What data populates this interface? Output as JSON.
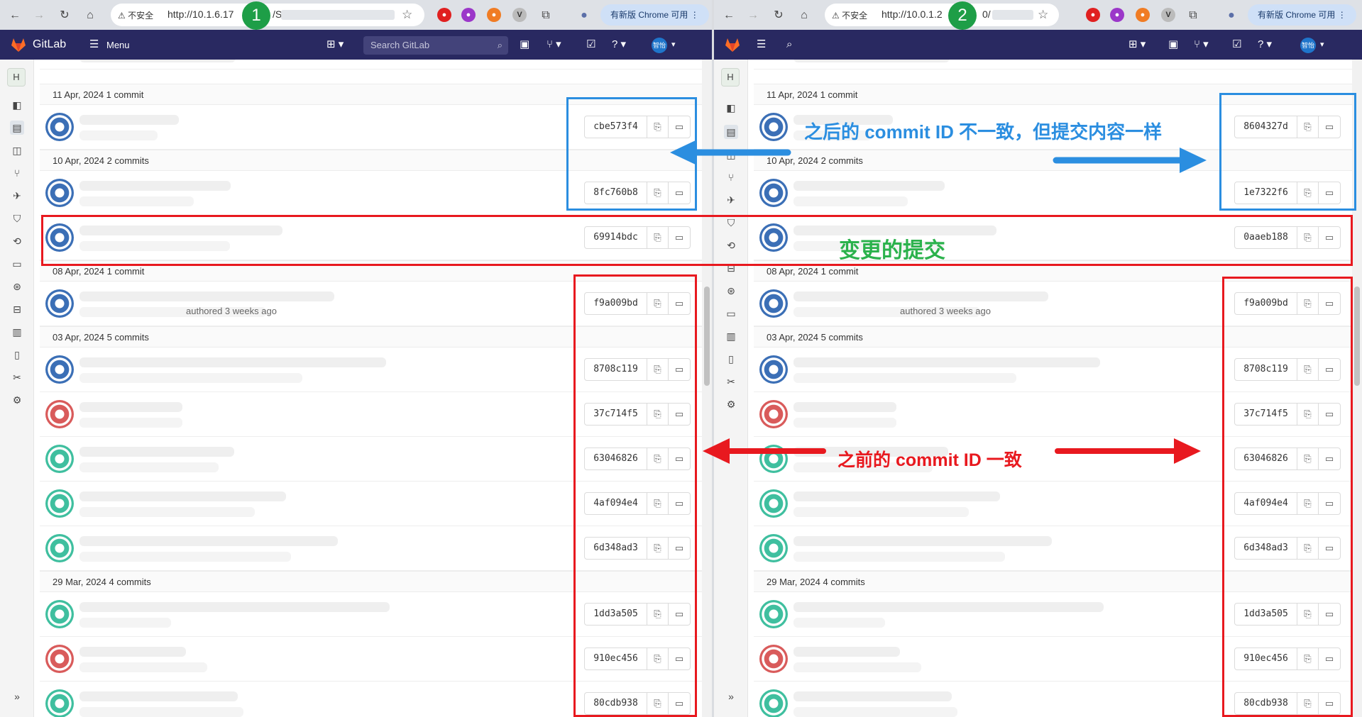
{
  "left": {
    "browser": {
      "insecure_label": "不安全",
      "url": "http://10.1.6.17",
      "url_tail": "/S",
      "update_label": "有新版 Chrome 可用",
      "marker": "1"
    },
    "gitlab": {
      "brand": "GitLab",
      "menu_label": "Menu",
      "search_placeholder": "Search GitLab",
      "avatar_text": "智怡",
      "sidebar_initial": "H"
    },
    "groups": [
      {
        "header": "11 Apr, 2024 1 commit",
        "rows": [
          {
            "sha": "cbe573f4"
          }
        ]
      },
      {
        "header": "10 Apr, 2024 2 commits",
        "rows": [
          {
            "sha": "8fc760b8"
          },
          {
            "sha": "69914bdc"
          }
        ]
      },
      {
        "header": "08 Apr, 2024 1 commit",
        "rows": [
          {
            "sha": "f9a009bd",
            "meta": "authored 3 weeks ago"
          }
        ]
      },
      {
        "header": "03 Apr, 2024 5 commits",
        "rows": [
          {
            "sha": "8708c119"
          },
          {
            "sha": "37c714f5"
          },
          {
            "sha": "63046826"
          },
          {
            "sha": "4af094e4"
          },
          {
            "sha": "6d348ad3"
          }
        ]
      },
      {
        "header": "29 Mar, 2024 4 commits",
        "rows": [
          {
            "sha": "1dd3a505"
          },
          {
            "sha": "910ec456"
          },
          {
            "sha": "80cdb938"
          }
        ]
      }
    ]
  },
  "right": {
    "browser": {
      "insecure_label": "不安全",
      "url": "http://10.0.1.2",
      "url_tail": "0/",
      "update_label": "有新版 Chrome 可用",
      "marker": "2"
    },
    "gitlab": {
      "avatar_text": "智怡",
      "sidebar_initial": "H"
    },
    "groups": [
      {
        "header": "11 Apr, 2024 1 commit",
        "rows": [
          {
            "sha": "8604327d"
          }
        ]
      },
      {
        "header": "10 Apr, 2024 2 commits",
        "rows": [
          {
            "sha": "1e7322f6"
          },
          {
            "sha": "0aaeb188"
          }
        ]
      },
      {
        "header": "08 Apr, 2024 1 commit",
        "rows": [
          {
            "sha": "f9a009bd",
            "meta": "authored 3 weeks ago"
          }
        ]
      },
      {
        "header": "03 Apr, 2024 5 commits",
        "rows": [
          {
            "sha": "8708c119"
          },
          {
            "sha": "37c714f5"
          },
          {
            "sha": "63046826"
          },
          {
            "sha": "4af094e4"
          },
          {
            "sha": "6d348ad3"
          }
        ]
      },
      {
        "header": "29 Mar, 2024 4 commits",
        "rows": [
          {
            "sha": "1dd3a505"
          },
          {
            "sha": "910ec456"
          },
          {
            "sha": "80cdb938"
          }
        ]
      }
    ]
  },
  "annotations": {
    "blue_note": "之后的 commit ID 不一致，但提交内容一样",
    "green_note": "变更的提交",
    "red_note": "之前的 commit ID 一致",
    "colors": {
      "red": "#e8191f",
      "blue": "#2b8ee0",
      "green": "#2bb24c"
    }
  }
}
